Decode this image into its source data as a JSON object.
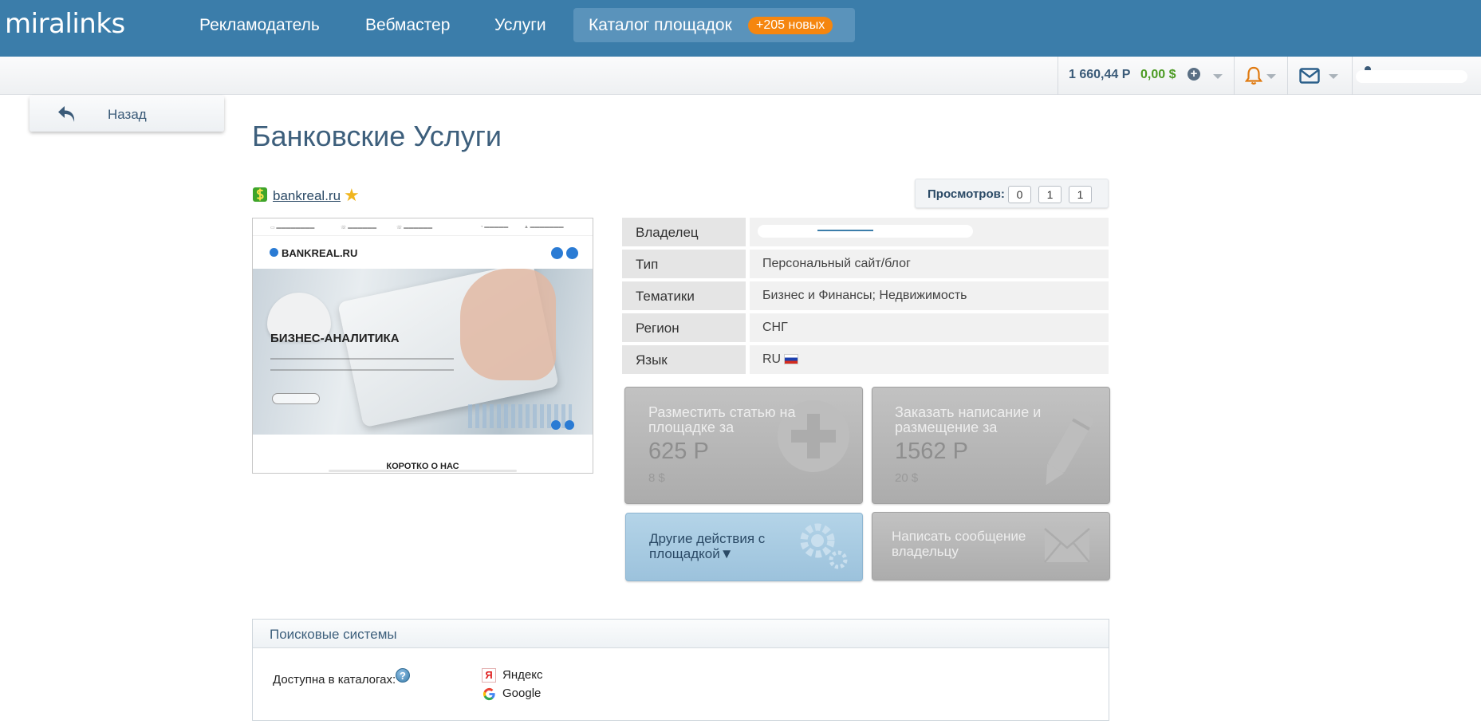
{
  "nav": {
    "logo": "miralinks",
    "items": [
      "Рекламодатель",
      "Вебмастер",
      "Услуги"
    ],
    "catalog_label": "Каталог площадок",
    "catalog_badge": "+205 новых"
  },
  "subbar": {
    "balance_rub": "1 660,44 Р",
    "balance_usd": "0,00 $"
  },
  "back_label": "Назад",
  "page_title": "Банковские Услуги",
  "site": {
    "domain": "bankreal.ru"
  },
  "views": {
    "label": "Просмотров:",
    "counts": [
      "0",
      "1",
      "1"
    ]
  },
  "preview": {
    "logo": "BANKREAL.RU",
    "hero_title": "БИЗНЕС-АНАЛИТИКА",
    "about": "КОРОТКО О НАС"
  },
  "info": [
    {
      "key": "Владелец",
      "value": ""
    },
    {
      "key": "Тип",
      "value": "Персональный сайт/блог"
    },
    {
      "key": "Тематики",
      "value": "Бизнес и Финансы; Недвижимость"
    },
    {
      "key": "Регион",
      "value": "СНГ"
    },
    {
      "key": "Язык",
      "value": "RU"
    }
  ],
  "actions": {
    "place_article": {
      "title": "Разместить статью на площадке за",
      "price": "625 Р",
      "usd": "8 $"
    },
    "order_writing": {
      "title": "Заказать написание и размещение за",
      "price": "1562 Р",
      "usd": "20 $"
    },
    "other_actions": {
      "title": "Другие действия с площадкой▼"
    },
    "message_owner": {
      "title": "Написать сообщение владельцу"
    }
  },
  "search_engines": {
    "heading": "Поисковые системы",
    "label": "Доступна в каталогах:",
    "items": [
      "Яндекс",
      "Google"
    ]
  },
  "colors": {
    "nav_bg": "#3b7daa",
    "badge": "#f5860f",
    "usd_green": "#4b9a22",
    "bell_orange": "#e07a10"
  }
}
